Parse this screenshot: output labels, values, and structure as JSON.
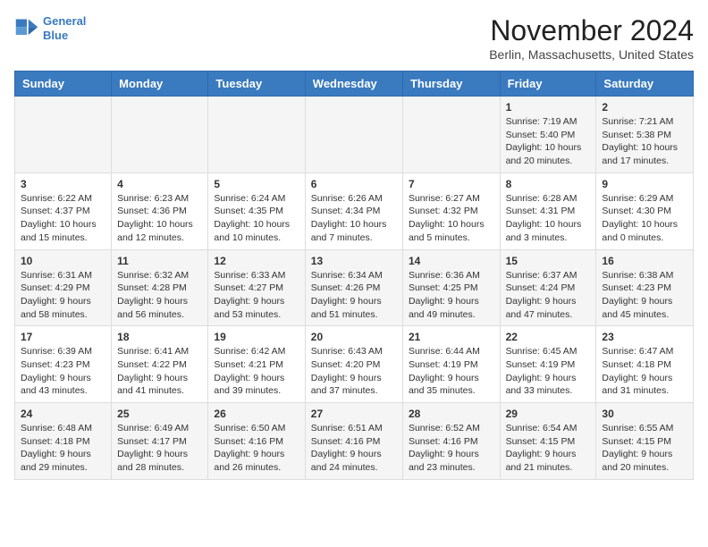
{
  "header": {
    "logo_line1": "General",
    "logo_line2": "Blue",
    "month_title": "November 2024",
    "location": "Berlin, Massachusetts, United States"
  },
  "weekdays": [
    "Sunday",
    "Monday",
    "Tuesday",
    "Wednesday",
    "Thursday",
    "Friday",
    "Saturday"
  ],
  "weeks": [
    [
      {
        "day": "",
        "info": ""
      },
      {
        "day": "",
        "info": ""
      },
      {
        "day": "",
        "info": ""
      },
      {
        "day": "",
        "info": ""
      },
      {
        "day": "",
        "info": ""
      },
      {
        "day": "1",
        "info": "Sunrise: 7:19 AM\nSunset: 5:40 PM\nDaylight: 10 hours and 20 minutes."
      },
      {
        "day": "2",
        "info": "Sunrise: 7:21 AM\nSunset: 5:38 PM\nDaylight: 10 hours and 17 minutes."
      }
    ],
    [
      {
        "day": "3",
        "info": "Sunrise: 6:22 AM\nSunset: 4:37 PM\nDaylight: 10 hours and 15 minutes."
      },
      {
        "day": "4",
        "info": "Sunrise: 6:23 AM\nSunset: 4:36 PM\nDaylight: 10 hours and 12 minutes."
      },
      {
        "day": "5",
        "info": "Sunrise: 6:24 AM\nSunset: 4:35 PM\nDaylight: 10 hours and 10 minutes."
      },
      {
        "day": "6",
        "info": "Sunrise: 6:26 AM\nSunset: 4:34 PM\nDaylight: 10 hours and 7 minutes."
      },
      {
        "day": "7",
        "info": "Sunrise: 6:27 AM\nSunset: 4:32 PM\nDaylight: 10 hours and 5 minutes."
      },
      {
        "day": "8",
        "info": "Sunrise: 6:28 AM\nSunset: 4:31 PM\nDaylight: 10 hours and 3 minutes."
      },
      {
        "day": "9",
        "info": "Sunrise: 6:29 AM\nSunset: 4:30 PM\nDaylight: 10 hours and 0 minutes."
      }
    ],
    [
      {
        "day": "10",
        "info": "Sunrise: 6:31 AM\nSunset: 4:29 PM\nDaylight: 9 hours and 58 minutes."
      },
      {
        "day": "11",
        "info": "Sunrise: 6:32 AM\nSunset: 4:28 PM\nDaylight: 9 hours and 56 minutes."
      },
      {
        "day": "12",
        "info": "Sunrise: 6:33 AM\nSunset: 4:27 PM\nDaylight: 9 hours and 53 minutes."
      },
      {
        "day": "13",
        "info": "Sunrise: 6:34 AM\nSunset: 4:26 PM\nDaylight: 9 hours and 51 minutes."
      },
      {
        "day": "14",
        "info": "Sunrise: 6:36 AM\nSunset: 4:25 PM\nDaylight: 9 hours and 49 minutes."
      },
      {
        "day": "15",
        "info": "Sunrise: 6:37 AM\nSunset: 4:24 PM\nDaylight: 9 hours and 47 minutes."
      },
      {
        "day": "16",
        "info": "Sunrise: 6:38 AM\nSunset: 4:23 PM\nDaylight: 9 hours and 45 minutes."
      }
    ],
    [
      {
        "day": "17",
        "info": "Sunrise: 6:39 AM\nSunset: 4:23 PM\nDaylight: 9 hours and 43 minutes."
      },
      {
        "day": "18",
        "info": "Sunrise: 6:41 AM\nSunset: 4:22 PM\nDaylight: 9 hours and 41 minutes."
      },
      {
        "day": "19",
        "info": "Sunrise: 6:42 AM\nSunset: 4:21 PM\nDaylight: 9 hours and 39 minutes."
      },
      {
        "day": "20",
        "info": "Sunrise: 6:43 AM\nSunset: 4:20 PM\nDaylight: 9 hours and 37 minutes."
      },
      {
        "day": "21",
        "info": "Sunrise: 6:44 AM\nSunset: 4:19 PM\nDaylight: 9 hours and 35 minutes."
      },
      {
        "day": "22",
        "info": "Sunrise: 6:45 AM\nSunset: 4:19 PM\nDaylight: 9 hours and 33 minutes."
      },
      {
        "day": "23",
        "info": "Sunrise: 6:47 AM\nSunset: 4:18 PM\nDaylight: 9 hours and 31 minutes."
      }
    ],
    [
      {
        "day": "24",
        "info": "Sunrise: 6:48 AM\nSunset: 4:18 PM\nDaylight: 9 hours and 29 minutes."
      },
      {
        "day": "25",
        "info": "Sunrise: 6:49 AM\nSunset: 4:17 PM\nDaylight: 9 hours and 28 minutes."
      },
      {
        "day": "26",
        "info": "Sunrise: 6:50 AM\nSunset: 4:16 PM\nDaylight: 9 hours and 26 minutes."
      },
      {
        "day": "27",
        "info": "Sunrise: 6:51 AM\nSunset: 4:16 PM\nDaylight: 9 hours and 24 minutes."
      },
      {
        "day": "28",
        "info": "Sunrise: 6:52 AM\nSunset: 4:16 PM\nDaylight: 9 hours and 23 minutes."
      },
      {
        "day": "29",
        "info": "Sunrise: 6:54 AM\nSunset: 4:15 PM\nDaylight: 9 hours and 21 minutes."
      },
      {
        "day": "30",
        "info": "Sunrise: 6:55 AM\nSunset: 4:15 PM\nDaylight: 9 hours and 20 minutes."
      }
    ]
  ]
}
